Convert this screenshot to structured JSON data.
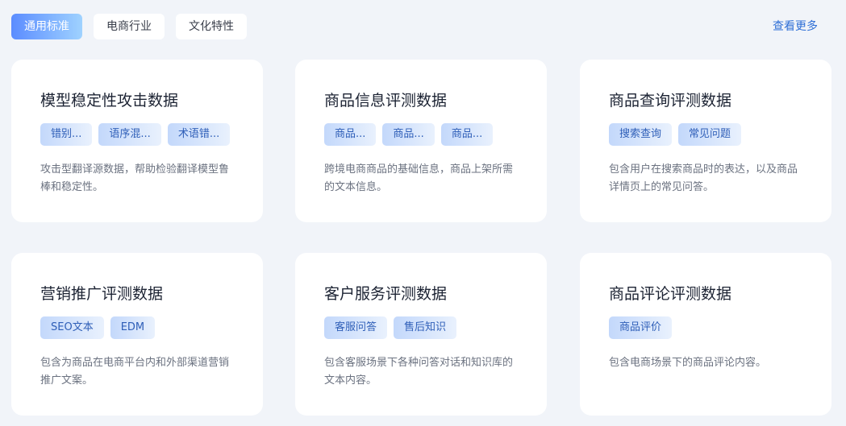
{
  "tabs": [
    {
      "label": "通用标准",
      "active": true
    },
    {
      "label": "电商行业",
      "active": false
    },
    {
      "label": "文化特性",
      "active": false
    }
  ],
  "more_label": "查看更多",
  "cards": [
    {
      "title": "模型稳定性攻击数据",
      "tags": [
        "错别...",
        "语序混...",
        "术语错..."
      ],
      "desc": "攻击型翻译源数据，帮助检验翻译模型鲁棒和稳定性。"
    },
    {
      "title": "商品信息评测数据",
      "tags": [
        "商品...",
        "商品...",
        "商品..."
      ],
      "desc": "跨境电商商品的基础信息，商品上架所需的文本信息。"
    },
    {
      "title": "商品查询评测数据",
      "tags": [
        "搜索查询",
        "常见问题"
      ],
      "desc": "包含用户在搜索商品时的表达，以及商品详情页上的常见问答。"
    },
    {
      "title": "营销推广评测数据",
      "tags": [
        "SEO文本",
        "EDM"
      ],
      "desc": "包含为商品在电商平台内和外部渠道营销推广文案。"
    },
    {
      "title": "客户服务评测数据",
      "tags": [
        "客服问答",
        "售后知识"
      ],
      "desc": "包含客服场景下各种问答对话和知识库的文本内容。"
    },
    {
      "title": "商品评论评测数据",
      "tags": [
        "商品评价"
      ],
      "desc": "包含电商场景下的商品评论内容。"
    }
  ],
  "colors": {
    "background": "#f1f4f9",
    "accent": "#5b8cff",
    "link": "#2f6fd6",
    "tag_text": "#2f5fb8"
  }
}
